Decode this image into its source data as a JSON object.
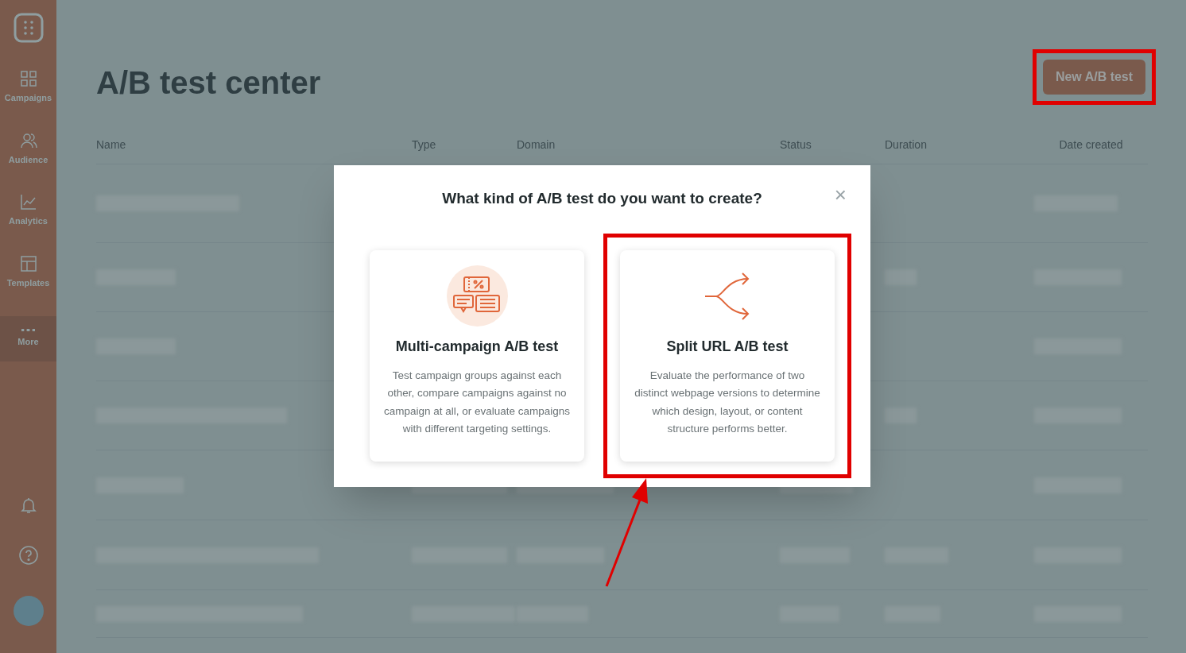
{
  "sidebar": {
    "items": [
      {
        "label": "Campaigns",
        "kind": "grid",
        "selected": false
      },
      {
        "label": "Audience",
        "kind": "people",
        "selected": false
      },
      {
        "label": "Analytics",
        "kind": "chart",
        "selected": false
      },
      {
        "label": "Templates",
        "kind": "layout",
        "selected": false
      },
      {
        "label": "More",
        "kind": "dots",
        "selected": true
      }
    ]
  },
  "page": {
    "title": "A/B test center",
    "new_button": {
      "label": "New A/B test",
      "highlighted": true
    }
  },
  "table": {
    "columns": [
      "Name",
      "Type",
      "Domain",
      "Status",
      "Duration",
      "Date created"
    ]
  },
  "dialog": {
    "title": "What kind of A/B test do you want to create?",
    "close": "×",
    "options": [
      {
        "kind": "multi",
        "title": "Multi-campaign A/B test",
        "description": "Test campaign groups against each other, compare campaigns against no campaign at all, or evaluate campaigns with different targeting settings.",
        "highlighted": false
      },
      {
        "kind": "split",
        "title": "Split URL A/B test",
        "description": "Evaluate the performance of two distinct webpage versions to determine which design, layout, or content structure performs better.",
        "highlighted": true
      }
    ]
  },
  "annotation_arrow": true
}
